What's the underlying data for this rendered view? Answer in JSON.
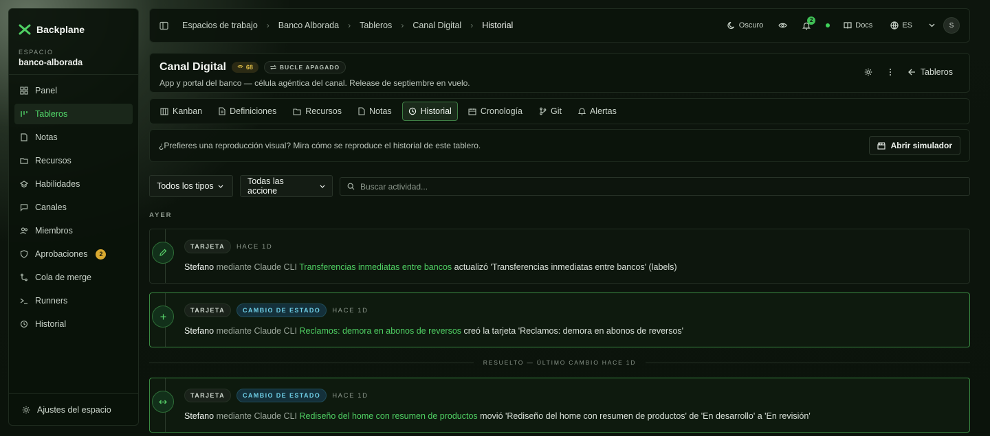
{
  "brand": {
    "name": "Backplane"
  },
  "workspace": {
    "label": "ESPACIO",
    "name": "banco-alborada"
  },
  "sidebar": {
    "items": [
      {
        "label": "Panel",
        "icon": "grid-icon"
      },
      {
        "label": "Tableros",
        "icon": "board-icon",
        "active": true
      },
      {
        "label": "Notas",
        "icon": "note-icon"
      },
      {
        "label": "Recursos",
        "icon": "folder-icon"
      },
      {
        "label": "Habilidades",
        "icon": "skills-icon"
      },
      {
        "label": "Canales",
        "icon": "chat-icon"
      },
      {
        "label": "Miembros",
        "icon": "users-icon"
      },
      {
        "label": "Aprobaciones",
        "icon": "shield-icon",
        "badge": "2"
      },
      {
        "label": "Cola de merge",
        "icon": "merge-icon"
      },
      {
        "label": "Runners",
        "icon": "runner-icon"
      },
      {
        "label": "Historial",
        "icon": "history-icon"
      }
    ],
    "footer": "Ajustes del espacio"
  },
  "breadcrumb": [
    "Espacios de trabajo",
    "Banco Alborada",
    "Tableros",
    "Canal Digital",
    "Historial"
  ],
  "topbar": {
    "theme": "Oscuro",
    "notifications": "2",
    "docs": "Docs",
    "language": "ES",
    "avatar": "S"
  },
  "board": {
    "name": "Canal Digital",
    "score": "68",
    "loop": "BUCLE APAGADO",
    "description": "App y portal del banco — célula agéntica del canal. Release de septiembre en vuelo.",
    "back": "Tableros"
  },
  "tabs": [
    {
      "label": "Kanban",
      "icon": "kanban-icon"
    },
    {
      "label": "Definiciones",
      "icon": "doc-icon"
    },
    {
      "label": "Recursos",
      "icon": "folder-icon"
    },
    {
      "label": "Notas",
      "icon": "note-icon"
    },
    {
      "label": "Historial",
      "icon": "clock-icon",
      "active": true
    },
    {
      "label": "Cronología",
      "icon": "timeline-icon"
    },
    {
      "label": "Git",
      "icon": "git-icon"
    },
    {
      "label": "Alertas",
      "icon": "bell-icon"
    }
  ],
  "simulator": {
    "text": "¿Prefieres una reproducción visual? Mira cómo se reproduce el historial de este tablero.",
    "button": "Abrir simulador"
  },
  "filters": {
    "types": "Todos los tipos",
    "actions": "Todas las accione",
    "search_placeholder": "Buscar actividad..."
  },
  "day_label": "AYER",
  "activities": [
    {
      "tags": [
        "TARJETA"
      ],
      "time": "HACE 1D",
      "actor": "Stefano",
      "via": "mediante Claude CLI",
      "link": "Transferencias inmediatas entre bancos",
      "action": "actualizó 'Transferencias inmediatas entre bancos' (labels)",
      "icon": "edit-icon"
    },
    {
      "tags": [
        "TARJETA",
        "CAMBIO DE ESTADO"
      ],
      "time": "HACE 1D",
      "actor": "Stefano",
      "via": "mediante Claude CLI",
      "link": "Reclamos: demora en abonos de reversos",
      "action": "creó la tarjeta 'Reclamos: demora en abonos de reversos'",
      "icon": "plus-icon"
    },
    {
      "tags": [
        "TARJETA",
        "CAMBIO DE ESTADO"
      ],
      "time": "HACE 1D",
      "actor": "Stefano",
      "via": "mediante Claude CLI",
      "link": "Rediseño del home con resumen de productos",
      "action": "movió 'Rediseño del home con resumen de productos' de 'En desarrollo' a 'En revisión'",
      "icon": "move-icon"
    }
  ],
  "resolved_divider": "RESUELTO — ÚLTIMO CAMBIO HACE 1D",
  "colors": {
    "accent": "#4fcf63",
    "status_tag": "#6fd0e8",
    "badge": "#d8a830"
  }
}
